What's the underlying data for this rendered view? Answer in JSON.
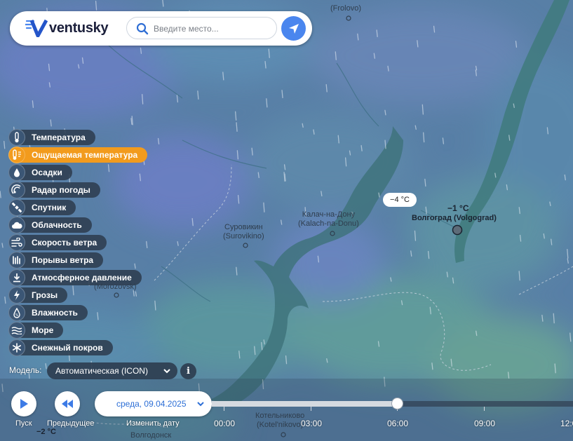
{
  "app": {
    "logo_text": "ventusky",
    "search_placeholder": "Введите место..."
  },
  "layers": [
    {
      "label": "Температура",
      "icon": "thermometer-icon",
      "active": false
    },
    {
      "label": "Ощущаемая температура",
      "icon": "feels-like-thermometer-icon",
      "active": true
    },
    {
      "label": "Осадки",
      "icon": "raindrop-icon",
      "active": false
    },
    {
      "label": "Радар погоды",
      "icon": "radar-icon",
      "active": false
    },
    {
      "label": "Спутник",
      "icon": "satellite-icon",
      "active": false
    },
    {
      "label": "Облачность",
      "icon": "cloud-icon",
      "active": false
    },
    {
      "label": "Скорость ветра",
      "icon": "wind-icon",
      "active": false
    },
    {
      "label": "Порывы ветра",
      "icon": "wind-gust-icon",
      "active": false
    },
    {
      "label": "Атмосферное давление",
      "icon": "pressure-icon",
      "active": false
    },
    {
      "label": "Грозы",
      "icon": "lightning-icon",
      "active": false
    },
    {
      "label": "Влажность",
      "icon": "humidity-icon",
      "active": false
    },
    {
      "label": "Море",
      "icon": "waves-icon",
      "active": false
    },
    {
      "label": "Снежный покров",
      "icon": "snowflake-icon",
      "active": false
    }
  ],
  "model": {
    "label": "Модель:",
    "selected": "Автоматическая (ICON)",
    "info": "i"
  },
  "controls": {
    "play_label": "Пуск",
    "prev_label": "Предыдущее",
    "change_date_label": "Изменить дату",
    "date_value": "среда, 09.04.2025"
  },
  "timeline": {
    "hours": [
      "00:00",
      "03:00",
      "06:00",
      "09:00",
      "12:0"
    ],
    "current_hour": "06:00"
  },
  "map": {
    "cities": [
      {
        "name": "Суровикин",
        "alt": "(Surovikino)"
      },
      {
        "name": "Калач-на-Дону",
        "alt": "(Kalach-na-Donu)"
      },
      {
        "name": "(Frolovo)",
        "alt": ""
      },
      {
        "name": "(Morozovsk)",
        "alt": ""
      },
      {
        "name": "Котельниково",
        "alt": "(Kotel'nikovo)"
      },
      {
        "name": "Волгодонск",
        "alt": ""
      }
    ],
    "volgograd": {
      "name": "Волгоград (Volgograd)",
      "temp": "−1 °C"
    },
    "temp_bubble": "−4 °C",
    "temp_bottom_left": "−2 °C"
  }
}
